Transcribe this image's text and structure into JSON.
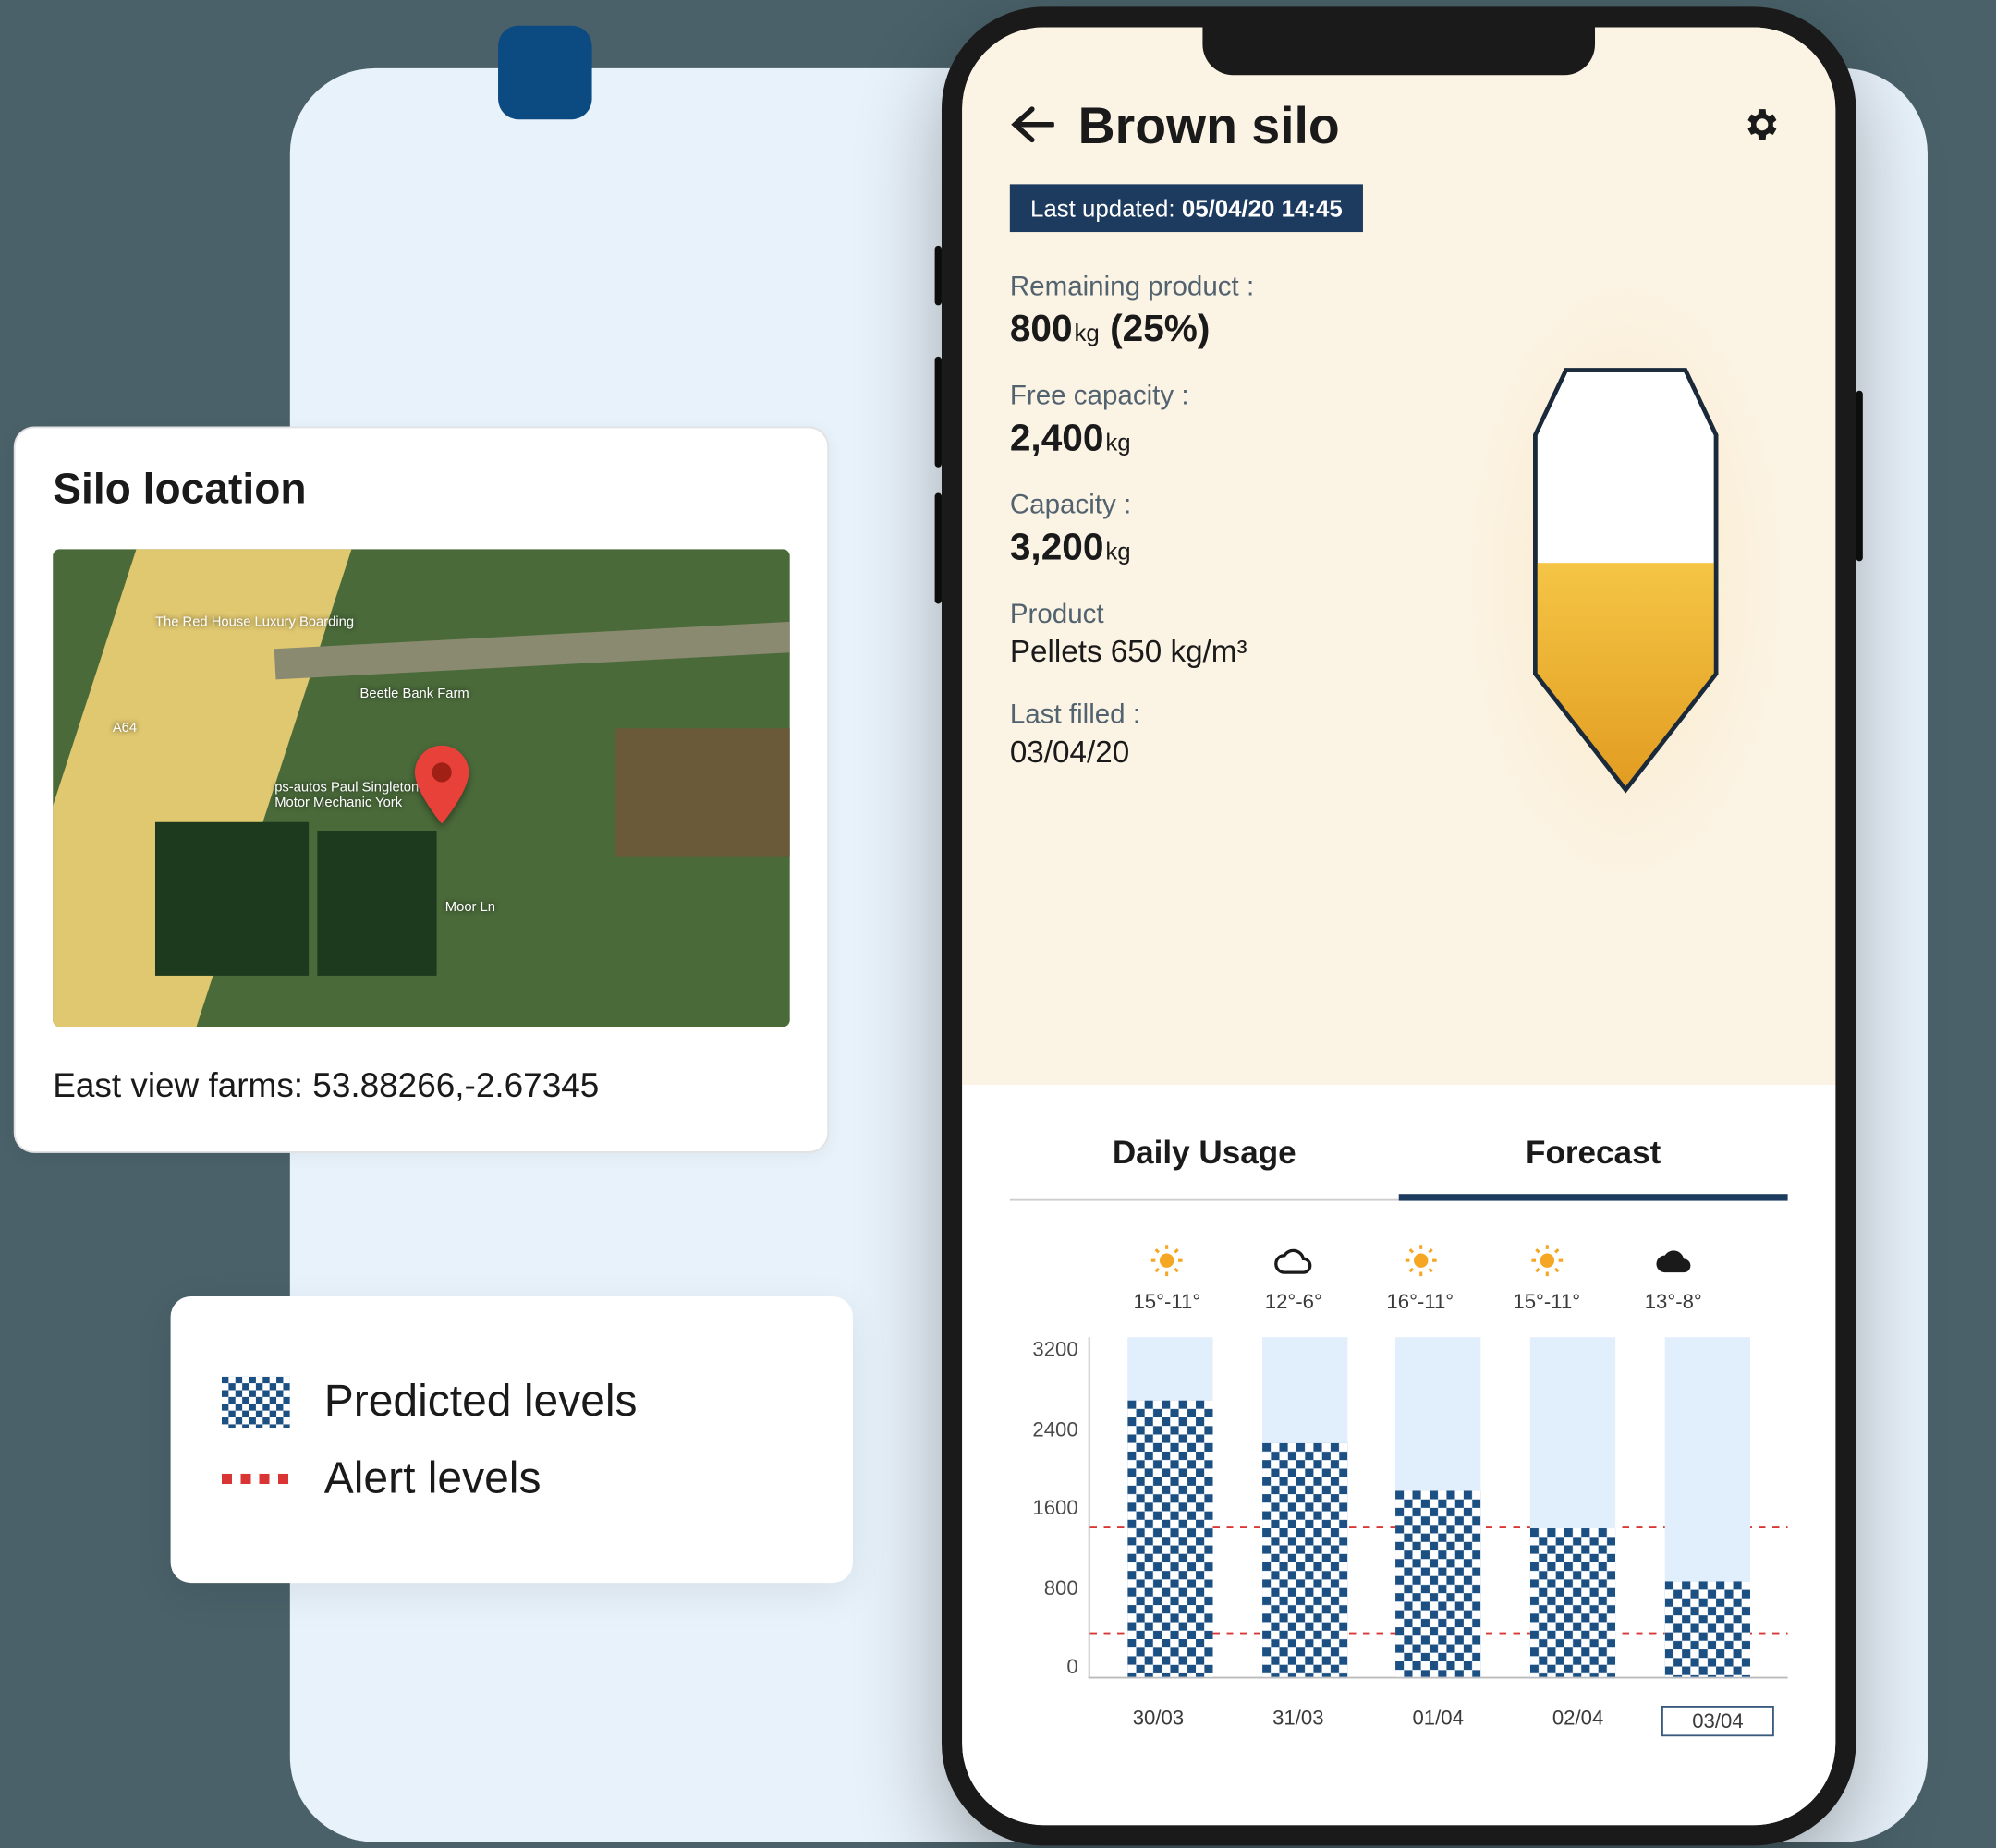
{
  "location_card": {
    "title": "Silo location",
    "map_labels": [
      "The Red House Luxury Boarding",
      "Beetle Bank Farm",
      "ps-autos Paul Singleton Motor Mechanic York",
      "A64",
      "Moor Ln"
    ],
    "farm_text": "East view farms: 53.88266,-2.67345"
  },
  "legend": {
    "predicted": "Predicted levels",
    "alert": "Alert levels"
  },
  "phone": {
    "title": "Brown silo",
    "last_updated_label": "Last updated:",
    "last_updated_value": "05/04/20 14:45",
    "metrics": {
      "remaining_label": "Remaining product :",
      "remaining_value": "800",
      "remaining_unit": "kg",
      "remaining_pct": "(25%)",
      "free_label": "Free capacity :",
      "free_value": "2,400",
      "free_unit": "kg",
      "capacity_label": "Capacity :",
      "capacity_value": "3,200",
      "capacity_unit": "kg",
      "product_label": "Product",
      "product_value": "Pellets 650 kg/m³",
      "lastfilled_label": "Last filled :",
      "lastfilled_value": "03/04/20"
    },
    "tabs": {
      "daily": "Daily Usage",
      "forecast": "Forecast"
    },
    "weather": [
      {
        "icon": "sun",
        "temp": "15°-11°"
      },
      {
        "icon": "cloud",
        "temp": "12°-6°"
      },
      {
        "icon": "sun",
        "temp": "16°-11°"
      },
      {
        "icon": "sun",
        "temp": "15°-11°"
      },
      {
        "icon": "darkcloud",
        "temp": "13°-8°"
      }
    ],
    "y_ticks": [
      "3200",
      "2400",
      "1600",
      "800",
      "0"
    ]
  },
  "chart_data": {
    "type": "bar",
    "title": "Forecast",
    "ylabel": "",
    "xlabel": "",
    "ylim": [
      0,
      3200
    ],
    "categories": [
      "30/03",
      "31/03",
      "01/04",
      "02/04",
      "03/04"
    ],
    "series": [
      {
        "name": "Predicted levels",
        "values": [
          2600,
          2200,
          1750,
          1400,
          900
        ]
      }
    ],
    "capacity": 3200,
    "alert_lines": [
      1400,
      400
    ],
    "highlighted_category": "03/04"
  }
}
